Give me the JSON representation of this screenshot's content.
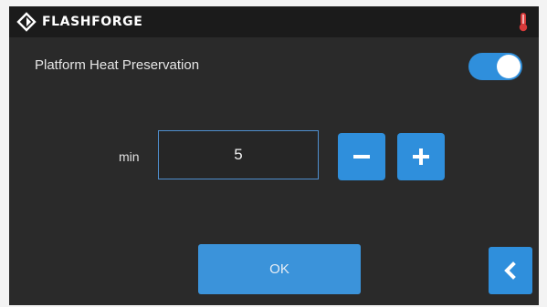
{
  "header": {
    "brand": "FLASHFORGE",
    "logo_icon": "flashforge-logo-icon",
    "status_icon": "thermometer-icon"
  },
  "setting": {
    "label": "Platform Heat Preservation",
    "toggle_on": true
  },
  "timer": {
    "unit_label": "min",
    "value": "5",
    "decrement_label": "−",
    "increment_label": "+"
  },
  "footer": {
    "ok_label": "OK",
    "back_icon": "chevron-left-icon"
  },
  "colors": {
    "accent": "#2f8fdc",
    "screen_bg": "#2a2a2a",
    "topbar_bg": "#1b1b1b",
    "alert_red": "#d93a3a"
  }
}
